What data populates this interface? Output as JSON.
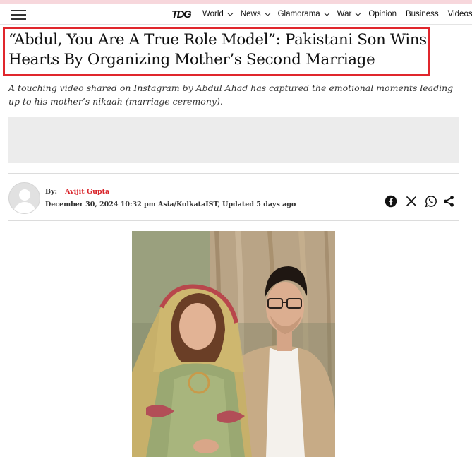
{
  "header": {
    "logo": "TDG",
    "nav": [
      {
        "label": "World",
        "has_dropdown": true
      },
      {
        "label": "News",
        "has_dropdown": true
      },
      {
        "label": "Glamorama",
        "has_dropdown": true
      },
      {
        "label": "War",
        "has_dropdown": true
      },
      {
        "label": "Opinion",
        "has_dropdown": false
      },
      {
        "label": "Business",
        "has_dropdown": false
      },
      {
        "label": "Videos",
        "has_dropdown": false
      }
    ]
  },
  "article": {
    "headline": "“Abdul, You Are A True Role Model”: Pakistani Son Wins Hearts By Organizing Mother’s Second Marriage",
    "summary": "A touching video shared on Instagram by Abdul Ahad has captured the emotional moments leading up to his mother’s nikaah (marriage ceremony).",
    "byline": {
      "by_label": "By:",
      "author": "Avijit Gupta",
      "date": "December 30, 2024 10:32 pm Asia/KolkataIST, Updated 5 days ago"
    },
    "share_icons": [
      "facebook-icon",
      "x-icon",
      "whatsapp-icon",
      "share-icon"
    ]
  },
  "colors": {
    "accent": "#d9252b",
    "highlight_box": "#e0262c",
    "ad_placeholder": "#ececec"
  }
}
